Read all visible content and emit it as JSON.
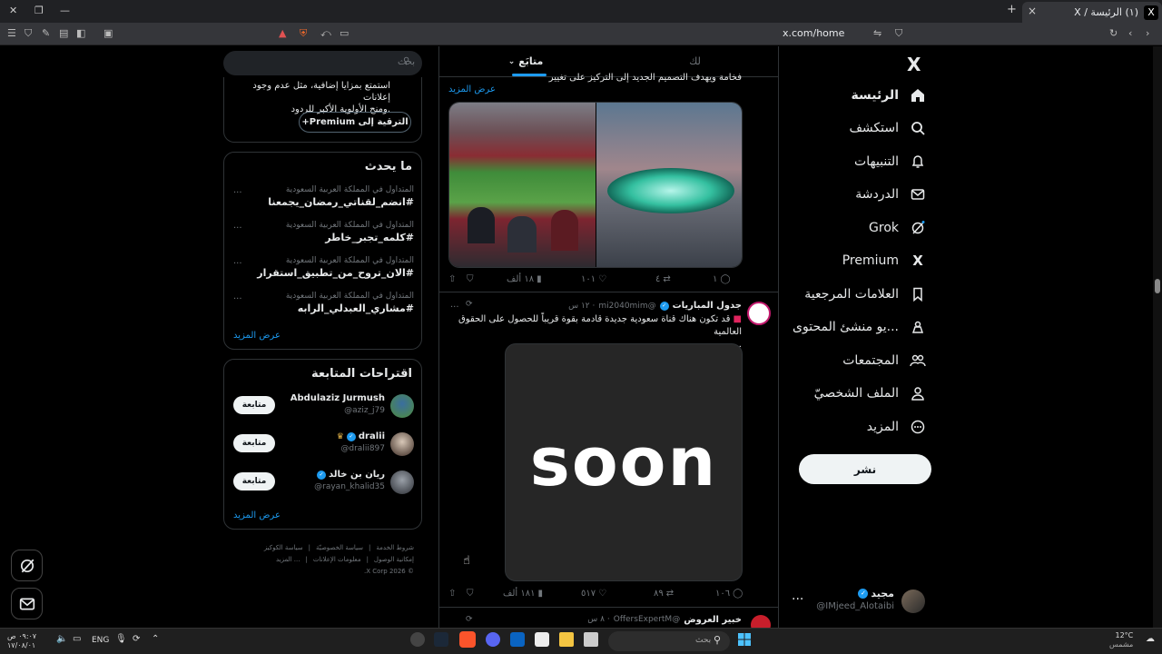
{
  "browser": {
    "tab_title": "(١) الرئيسة / X",
    "tab_logo": "X",
    "tab_close": "×",
    "new_tab": "+",
    "url": "x.com/home"
  },
  "nav": {
    "logo": "X",
    "items": [
      {
        "label": "الرئيسة",
        "icon": "home-icon"
      },
      {
        "label": "استكشف",
        "icon": "search-icon"
      },
      {
        "label": "التنبيهات",
        "icon": "bell-icon"
      },
      {
        "label": "الدردشة",
        "icon": "mail-icon"
      },
      {
        "label": "Grok",
        "icon": "grok-icon"
      },
      {
        "label": "Premium",
        "icon": "x-icon"
      },
      {
        "label": "العلامات المرجعية",
        "icon": "bookmark-icon"
      },
      {
        "label": "...يو منشئ المحتوى",
        "icon": "creator-icon"
      },
      {
        "label": "المجتمعات",
        "icon": "communities-icon"
      },
      {
        "label": "الملف الشخصيّ",
        "icon": "profile-icon"
      },
      {
        "label": "المزيد",
        "icon": "more-icon"
      }
    ],
    "post_label": "نشر",
    "account": {
      "name": "مجيد",
      "handle": "@IMjeed_Alotaibi",
      "more": "..."
    }
  },
  "feed": {
    "tabs": [
      {
        "label": "لك"
      },
      {
        "label": "متابَع"
      }
    ],
    "post1": {
      "text_tail": "فخامة ويهدف التصميم الجديد إلى التركيز على تغيير",
      "show_more": "عرض المزيد",
      "replies": "١",
      "reposts": "٤",
      "likes": "١٠١",
      "views": "١٨ ألف"
    },
    "post2": {
      "author": "جدول المباريات",
      "handle": "@mi2040mim",
      "time": "· ١٢ س",
      "text": "قد تكون هناك قناة سعودية جديدة قادمة بقوة قريباً للحصول على الحقوق العالمية",
      "ellipsis": "...",
      "media_text": "soon",
      "replies": "١٠٦",
      "reposts": "٨٩",
      "likes": "٥١٧",
      "views": "١٨١ ألف",
      "more": "..."
    },
    "post3": {
      "author": "خبير العروض",
      "handle": "@OffersExpertM",
      "time": "· ٨ س"
    }
  },
  "sidebar": {
    "search_placeholder": "بحث",
    "premium": {
      "text1": "استمتع بمزايا إضافية، مثل عدم وجود إعلانات",
      "text2": ".ومنح الأولوية الأكبر للردود",
      "button": "الترقية إلى Premium+"
    },
    "trends_title": "ما يحدث",
    "trends": [
      {
        "meta": "المتداول في المملكة العربية السعودية",
        "tag": "#انضم_لقناتي_رمضان_يجمعنا"
      },
      {
        "meta": "المتداول في المملكة العربية السعودية",
        "tag": "#كلمه_تجبر_خاطر"
      },
      {
        "meta": "المتداول في المملكة العربية السعودية",
        "tag": "#الان_تروح_من_تطبيق_استقرار"
      },
      {
        "meta": "المتداول في المملكة العربية السعودية",
        "tag": "#مشاري_العبدلي_الرابه"
      }
    ],
    "trend_more": "...",
    "trends_show_more": "عرض المزيد",
    "follow_title": "اقتراحات المتابعة",
    "follow": [
      {
        "name": "Abdulaziz Jurmush",
        "handle": "@aziz_j79",
        "button": "متابعة"
      },
      {
        "name": "dralii",
        "handle": "@dralii897",
        "button": "متابعة"
      },
      {
        "name": "ريان بن خالد",
        "handle": "@rayan_khalid35",
        "button": "متابعة"
      }
    ],
    "follow_show_more": "عرض المزيد",
    "footer": {
      "line1": [
        "شروط الخدمة",
        "سياسة الخصوصيّة",
        "سياسة الكوكيز"
      ],
      "line2": [
        "إمكانية الوصول",
        "معلومات الإعلانات",
        "... المزيد"
      ],
      "copyright": "© 2026 X Corp."
    }
  },
  "taskbar": {
    "search_placeholder": "بحث",
    "weather_temp": "12°C",
    "weather_text": "مشمس",
    "lang": "ENG",
    "time": "٠٩:٠٧ ص",
    "date": "١٧/٠٨/٠١"
  },
  "colors": {
    "accent": "#1d9bf0",
    "background": "#000000",
    "border": "#2f3336",
    "muted": "#71767b"
  }
}
